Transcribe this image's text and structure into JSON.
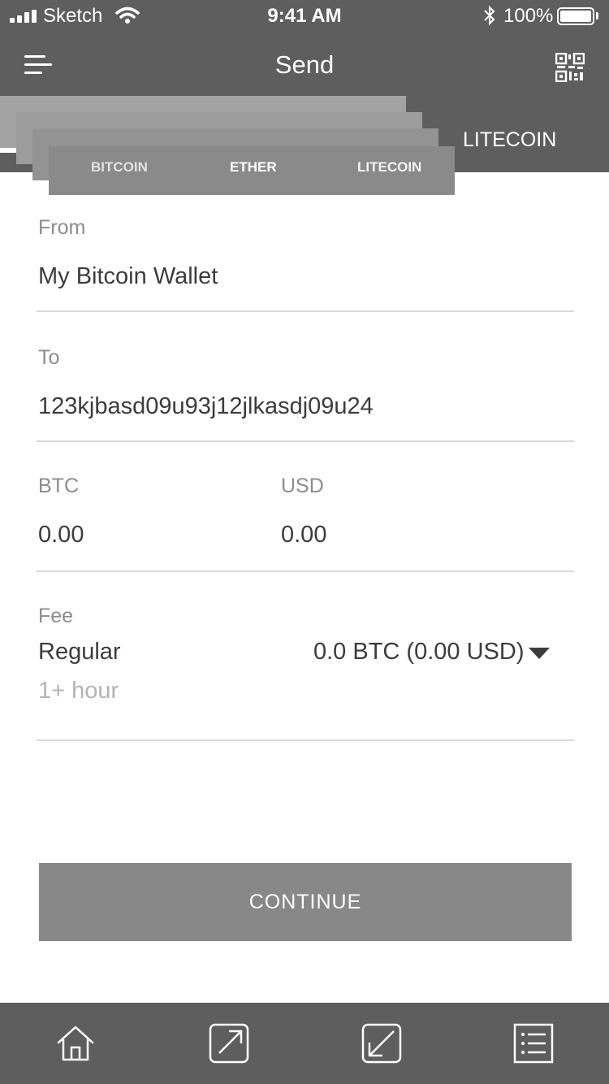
{
  "status_bar": {
    "carrier": "Sketch",
    "time": "9:41 AM",
    "battery": "100%"
  },
  "nav": {
    "title": "Send",
    "menu_icon": "menu-icon",
    "scan_icon": "qr-code-icon"
  },
  "currency_tabs": {
    "selected": "LITECOIN",
    "cards": [
      "BITCOIN",
      "ETHER",
      "LITECOIN"
    ]
  },
  "form": {
    "from_label": "From",
    "from_value": "My Bitcoin Wallet",
    "to_label": "To",
    "to_value": "123kjbasd09u93j12jlkasdj09u24",
    "btc_label": "BTC",
    "btc_value": "0.00",
    "usd_label": "USD",
    "usd_value": "0.00",
    "fee_label": "Fee",
    "fee_speed": "Regular",
    "fee_amount": "0.0 BTC (0.00 USD)",
    "fee_time": "1+ hour"
  },
  "continue_label": "CONTINUE",
  "tab_bar": [
    "home-icon",
    "send-icon",
    "receive-icon",
    "transactions-icon"
  ]
}
